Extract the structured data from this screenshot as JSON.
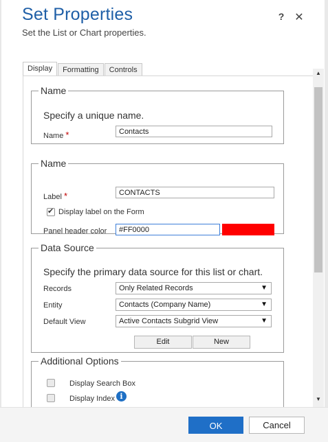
{
  "header": {
    "title": "Set Properties",
    "subtitle": "Set the List or Chart properties.",
    "help_label": "?",
    "close_label": "✕"
  },
  "tabs": [
    {
      "label": "Display"
    },
    {
      "label": "Formatting"
    },
    {
      "label": "Controls"
    }
  ],
  "name_section": {
    "legend": "Name",
    "description": "Specify a unique name.",
    "field_label": "Name",
    "required_mark": "*",
    "value": "Contacts"
  },
  "label_section": {
    "legend": "Name",
    "label_field": "Label",
    "required_mark": "*",
    "label_value": "CONTACTS",
    "display_label_checkbox": "Display label on the Form",
    "display_label_checked": true,
    "panel_header_color_label": "Panel header color",
    "panel_header_color_value": "#FF0000",
    "swatch_color": "#ff0000"
  },
  "data_source": {
    "legend": "Data Source",
    "description": "Specify the primary data source for this list or chart.",
    "records_label": "Records",
    "records_value": "Only Related Records",
    "entity_label": "Entity",
    "entity_value": "Contacts (Company Name)",
    "default_view_label": "Default View",
    "default_view_value": "Active Contacts Subgrid View",
    "edit_label": "Edit",
    "new_label": "New"
  },
  "additional_options": {
    "legend": "Additional Options",
    "search_box_label": "Display Search Box",
    "index_label": "Display Index",
    "info_icon_glyph": "i"
  },
  "scrollbar": {
    "up_glyph": "▲",
    "down_glyph": "▼"
  },
  "footer": {
    "ok_label": "OK",
    "cancel_label": "Cancel"
  },
  "colors": {
    "title": "#1f5fa7",
    "primary_button": "#1f6fc7",
    "required": "#c00000",
    "info_icon": "#1e6fc4"
  }
}
